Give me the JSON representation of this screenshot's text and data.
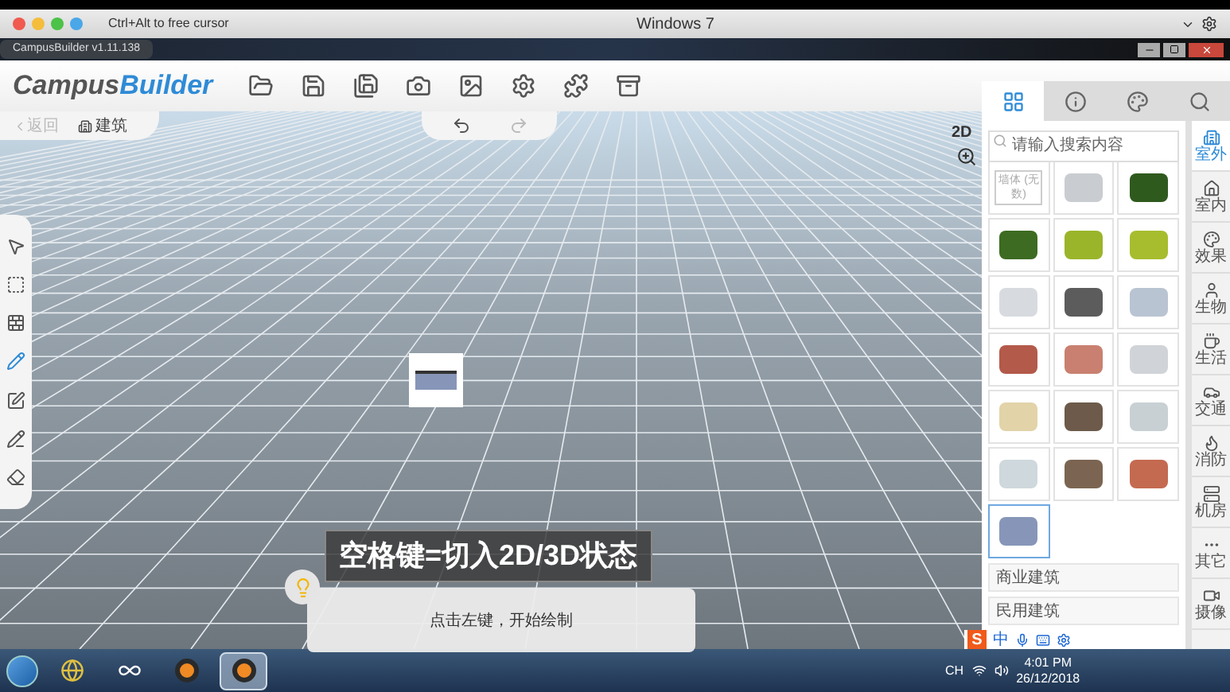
{
  "host_bar": {
    "hint": "Ctrl+Alt to free cursor",
    "title": "Windows 7"
  },
  "vm_window": {
    "tab_title": "CampusBuilder v1.11.138"
  },
  "app": {
    "logo_first": "Campus",
    "logo_second": "Builder"
  },
  "breadcrumb": {
    "back": "返回",
    "back_disabled": true,
    "current": "建筑"
  },
  "view_mode": "2D",
  "panel_tabs": [
    {
      "kind": "grid",
      "selected": true
    },
    {
      "kind": "info",
      "selected": false
    },
    {
      "kind": "palette",
      "selected": false
    },
    {
      "kind": "search",
      "selected": false
    }
  ],
  "search": {
    "placeholder": "请输入搜索内容"
  },
  "models": [
    {
      "label": "墙体 (无数)",
      "selected": false
    },
    {
      "selected": false
    },
    {
      "selected": false
    },
    {
      "selected": false
    },
    {
      "selected": false
    },
    {
      "selected": false
    },
    {
      "selected": false
    },
    {
      "selected": false
    },
    {
      "selected": false
    },
    {
      "selected": false
    },
    {
      "selected": false
    },
    {
      "selected": false
    },
    {
      "selected": false
    },
    {
      "selected": false
    },
    {
      "selected": false
    },
    {
      "selected": false
    },
    {
      "selected": false
    },
    {
      "selected": false
    },
    {
      "selected": true
    }
  ],
  "groups": [
    {
      "label": "商业建筑"
    },
    {
      "label": "民用建筑"
    }
  ],
  "categories": [
    {
      "kind": "outdoor",
      "label": "室外",
      "selected": true
    },
    {
      "kind": "indoor",
      "label": "室内",
      "selected": false
    },
    {
      "kind": "effect",
      "label": "效果",
      "selected": false
    },
    {
      "kind": "creature",
      "label": "生物",
      "selected": false
    },
    {
      "kind": "life",
      "label": "生活",
      "selected": false
    },
    {
      "kind": "traffic",
      "label": "交通",
      "selected": false
    },
    {
      "kind": "fire",
      "label": "消防",
      "selected": false
    },
    {
      "kind": "server",
      "label": "机房",
      "selected": false
    },
    {
      "kind": "more",
      "label": "其它",
      "selected": false
    },
    {
      "kind": "camera",
      "label": "摄像",
      "selected": false
    }
  ],
  "tools": [
    {
      "kind": "pointer",
      "selected": false
    },
    {
      "kind": "select",
      "selected": false
    },
    {
      "kind": "wall",
      "selected": false
    },
    {
      "kind": "pencil",
      "selected": true
    },
    {
      "kind": "edit",
      "selected": false
    },
    {
      "kind": "pen-add",
      "selected": false
    },
    {
      "kind": "eraser",
      "selected": false
    }
  ],
  "caption": "空格键=切入2D/3D状态",
  "tip": "点击左键，开始绘制",
  "ime": {
    "logo": "S",
    "mode": "中"
  },
  "taskbar": {
    "items": [
      {
        "kind": "browser",
        "selected": false
      },
      {
        "kind": "link",
        "selected": false
      },
      {
        "kind": "app",
        "selected": false
      },
      {
        "kind": "app",
        "selected": true
      }
    ],
    "lang": "CH",
    "time": "4:01 PM",
    "date": "26/12/2018"
  }
}
